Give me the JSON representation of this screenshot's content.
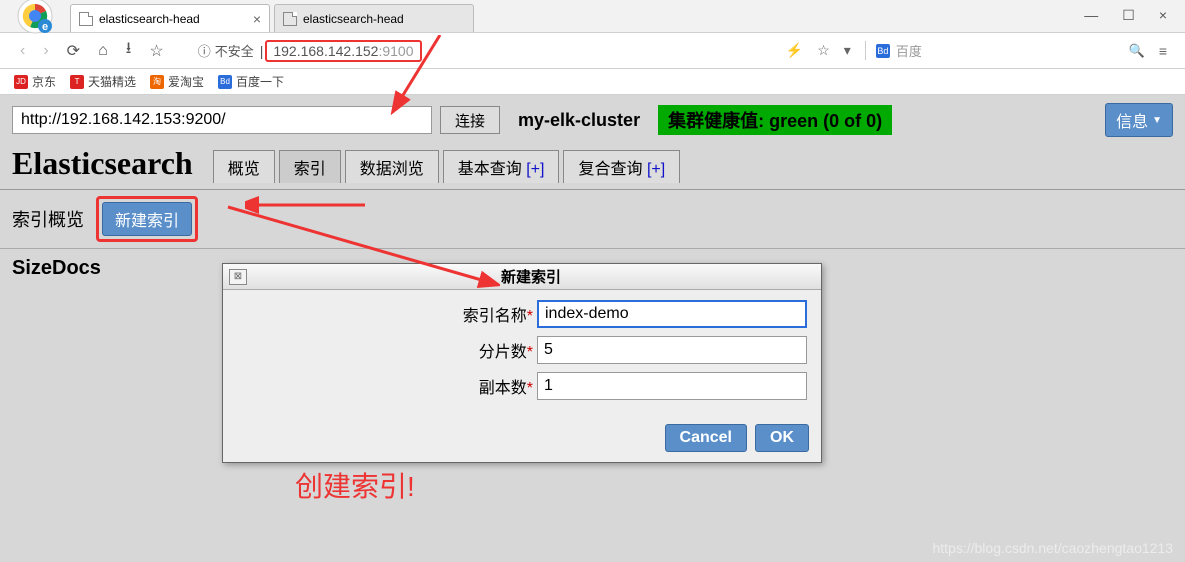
{
  "browser": {
    "tabs": [
      {
        "title": "elasticsearch-head",
        "active": true
      },
      {
        "title": "elasticsearch-head",
        "active": false
      }
    ],
    "insecure_label": "不安全",
    "url_host": "192.168.142.152",
    "url_port": ":9100",
    "search_placeholder": "百度",
    "bookmarks": [
      {
        "label": "京东",
        "bg": "#d22"
      },
      {
        "label": "天猫精选",
        "bg": "#d22"
      },
      {
        "label": "爱淘宝",
        "bg": "#e60"
      },
      {
        "label": "百度一下",
        "bg": "#2b6cdb"
      }
    ]
  },
  "app": {
    "connect_url": "http://192.168.142.153:9200/",
    "connect_btn": "连接",
    "cluster_name": "my-elk-cluster",
    "health_label": "集群健康值: green (0 of 0)",
    "info_btn": "信息",
    "title": "Elasticsearch",
    "tabs": {
      "overview": "概览",
      "indices": "索引",
      "browse": "数据浏览",
      "basic_query": "基本查询",
      "compound_query": "复合查询",
      "plus": "[+]"
    },
    "index_overview_label": "索引概览",
    "new_index_btn": "新建索引",
    "table_headers": "SizeDocs"
  },
  "dialog": {
    "title": "新建索引",
    "fields": {
      "name_label": "索引名称",
      "name_value": "index-demo",
      "shards_label": "分片数",
      "shards_value": "5",
      "replicas_label": "副本数",
      "replicas_value": "1"
    },
    "cancel": "Cancel",
    "ok": "OK"
  },
  "annotations": {
    "create_index": "创建索引!"
  },
  "watermark": "https://blog.csdn.net/caozhengtao1213"
}
